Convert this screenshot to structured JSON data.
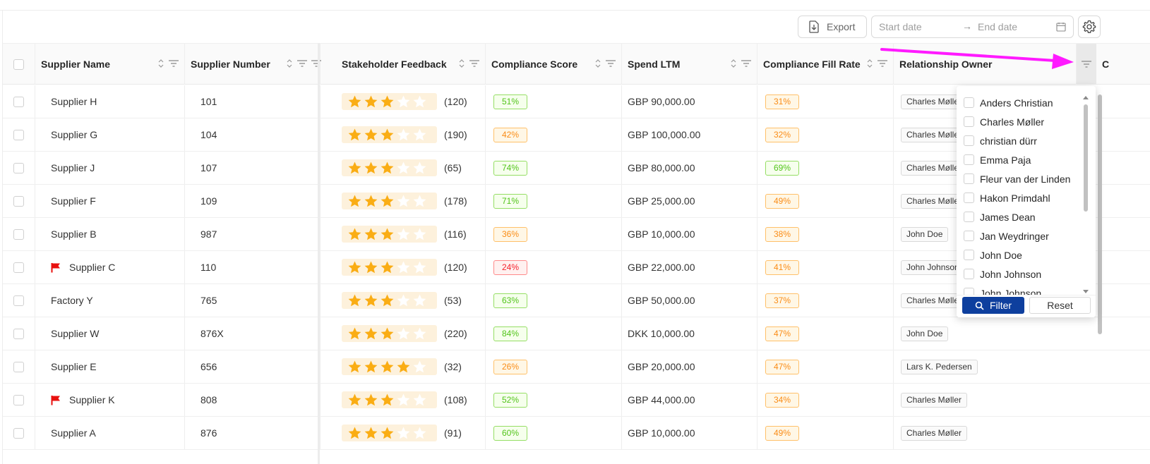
{
  "toolbar": {
    "export_label": "Export",
    "start_placeholder": "Start date",
    "end_placeholder": "End date",
    "range_arrow": "→"
  },
  "columns": [
    {
      "label": "Supplier Name"
    },
    {
      "label": "Supplier Number"
    },
    {
      "label": "Stakeholder Feedback"
    },
    {
      "label": "Compliance Score"
    },
    {
      "label": "Spend LTM"
    },
    {
      "label": "Compliance Fill Rate"
    },
    {
      "label": "Relationship Owner"
    },
    {
      "label": "C"
    }
  ],
  "rows": [
    {
      "name": "Supplier H",
      "flagged": false,
      "number": "101",
      "stars": 3,
      "reviews": "(120)",
      "score": "51%",
      "score_level": "green",
      "spend": "GBP 90,000.00",
      "fill": "31%",
      "fill_level": "orange",
      "owner": "Charles Møller"
    },
    {
      "name": "Supplier G",
      "flagged": false,
      "number": "104",
      "stars": 3,
      "reviews": "(190)",
      "score": "42%",
      "score_level": "orange",
      "spend": "GBP 100,000.00",
      "fill": "32%",
      "fill_level": "orange",
      "owner": "Charles Møller"
    },
    {
      "name": "Supplier J",
      "flagged": false,
      "number": "107",
      "stars": 3,
      "reviews": "(65)",
      "score": "74%",
      "score_level": "green",
      "spend": "GBP 80,000.00",
      "fill": "69%",
      "fill_level": "green",
      "owner": "Charles Møller"
    },
    {
      "name": "Supplier F",
      "flagged": false,
      "number": "109",
      "stars": 3,
      "reviews": "(178)",
      "score": "71%",
      "score_level": "green",
      "spend": "GBP 25,000.00",
      "fill": "49%",
      "fill_level": "orange",
      "owner": "Charles Møller"
    },
    {
      "name": "Supplier B",
      "flagged": false,
      "number": "987",
      "stars": 3,
      "reviews": "(116)",
      "score": "36%",
      "score_level": "orange",
      "spend": "GBP 10,000.00",
      "fill": "38%",
      "fill_level": "orange",
      "owner": "John  Doe"
    },
    {
      "name": "Supplier C",
      "flagged": true,
      "number": "110",
      "stars": 3,
      "reviews": "(120)",
      "score": "24%",
      "score_level": "red",
      "spend": "GBP 22,000.00",
      "fill": "41%",
      "fill_level": "orange",
      "owner": "John Johnson"
    },
    {
      "name": "Factory Y",
      "flagged": false,
      "number": "765",
      "stars": 3,
      "reviews": "(53)",
      "score": "63%",
      "score_level": "green",
      "spend": "GBP 50,000.00",
      "fill": "37%",
      "fill_level": "orange",
      "owner": "Charles Møller"
    },
    {
      "name": "Supplier W",
      "flagged": false,
      "number": "876X",
      "stars": 3,
      "reviews": "(220)",
      "score": "84%",
      "score_level": "green",
      "spend": "DKK 10,000.00",
      "fill": "47%",
      "fill_level": "orange",
      "owner": "John  Doe"
    },
    {
      "name": "Supplier E",
      "flagged": false,
      "number": "656",
      "stars": 4,
      "reviews": "(32)",
      "score": "26%",
      "score_level": "orange",
      "spend": "GBP 20,000.00",
      "fill": "47%",
      "fill_level": "orange",
      "owner": "Lars K. Pedersen"
    },
    {
      "name": "Supplier K",
      "flagged": true,
      "number": "808",
      "stars": 3,
      "reviews": "(108)",
      "score": "52%",
      "score_level": "green",
      "spend": "GBP 44,000.00",
      "fill": "34%",
      "fill_level": "orange",
      "owner": "Charles Møller"
    },
    {
      "name": "Supplier A",
      "flagged": false,
      "number": "876",
      "stars": 3,
      "reviews": "(91)",
      "score": "60%",
      "score_level": "green",
      "spend": "GBP 10,000.00",
      "fill": "49%",
      "fill_level": "orange",
      "owner": "Charles Møller"
    }
  ],
  "owner_filter": {
    "options": [
      "Anders Christian",
      "Charles Møller",
      "christian dürr",
      "Emma Paja",
      "Fleur van der Linden",
      "Hakon Primdahl",
      "James Dean",
      "Jan Weydringer",
      "John Doe",
      "John Johnson",
      "John Johnson"
    ],
    "filter_label": "Filter",
    "reset_label": "Reset"
  },
  "colors": {
    "primary": "#0e3f9e",
    "star": "#faad14",
    "flag": "#e8110f",
    "annotation_arrow": "#ff1aff"
  }
}
